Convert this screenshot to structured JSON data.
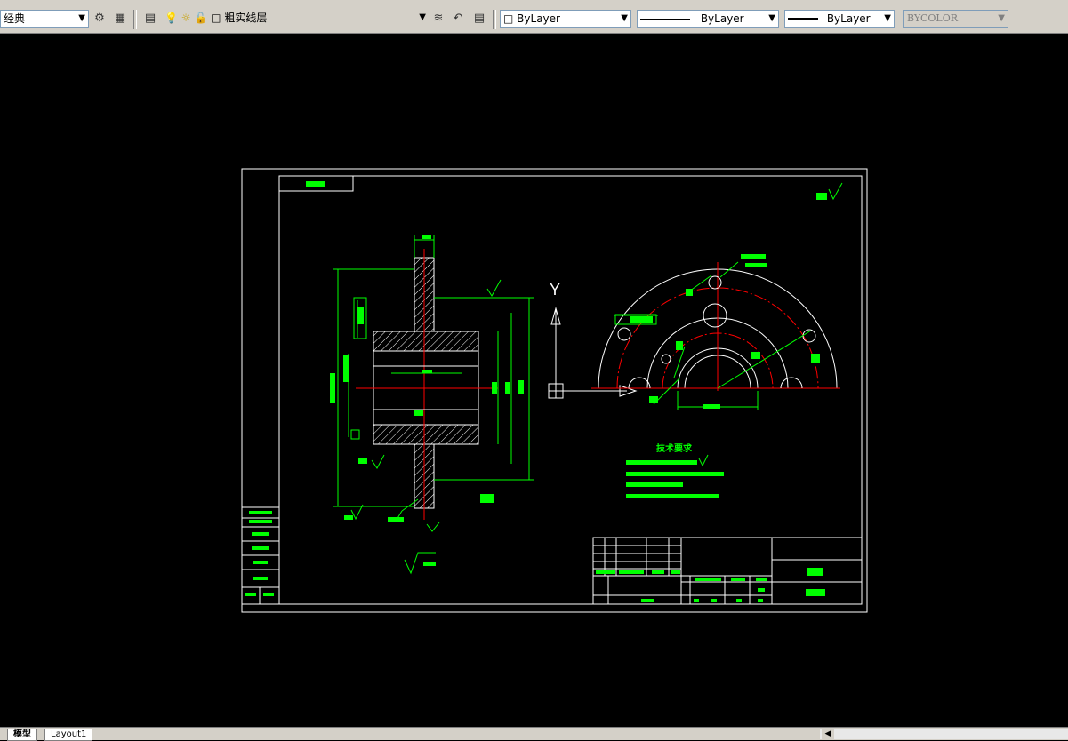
{
  "toolbar": {
    "workspace": "经典",
    "layer_name": "粗实线层",
    "color_combo": "ByLayer",
    "linetype_combo": "ByLayer",
    "lineweight_combo": "ByLayer",
    "plotstyle_combo": "BYCOLOR"
  },
  "drawing": {
    "ucs_y": "Y",
    "tech_title": "技术要求",
    "tech_lines": [
      "1.",
      "2.",
      "3.",
      "4."
    ]
  },
  "tabs": [
    "模型",
    "Layout1"
  ],
  "colors": {
    "line_green": "#00ff00",
    "line_red": "#ff0000",
    "line_white": "#ffffff",
    "line_yellow": "#ffff00"
  }
}
